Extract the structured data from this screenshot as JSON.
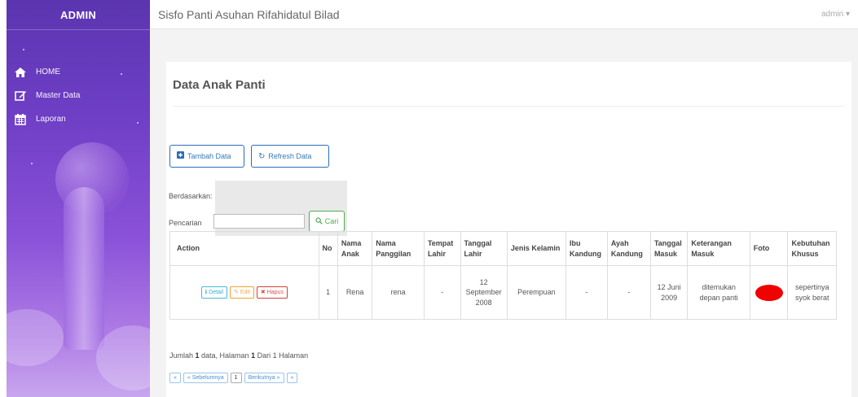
{
  "sidebar": {
    "brand": "ADMIN",
    "items": [
      {
        "label": "HOME",
        "icon": "home-icon"
      },
      {
        "label": "Master Data",
        "icon": "edit-icon"
      },
      {
        "label": "Laporan",
        "icon": "calendar-icon"
      }
    ]
  },
  "topbar": {
    "title": "Sisfo Panti Asuhan Rifahidatul Bilad",
    "user": "admin ▾"
  },
  "page": {
    "title": "Data Anak Panti",
    "btn_add": "Tambah Data",
    "btn_refresh": "Refresh Data",
    "filter_label": "Berdasarkan:",
    "search_label": "Pencarian",
    "btn_search": "Cari"
  },
  "table": {
    "headers": [
      "Action",
      "No",
      "Nama Anak",
      "Nama Panggilan",
      "Tempat Lahir",
      "Tanggal Lahir",
      "Jenis Kelamin",
      "Ibu Kandung",
      "Ayah Kandung",
      "Tanggal Masuk",
      "Keterangan Masuk",
      "Foto",
      "Kebutuhan Khusus"
    ],
    "actions": {
      "detail": "Detail",
      "edit": "Edit",
      "hapus": "Hapus"
    },
    "rows": [
      {
        "no": "1",
        "nama_anak": "Rena",
        "nama_panggilan": "rena",
        "tempat_lahir": "-",
        "tanggal_lahir": "12 September 2008",
        "jenis_kelamin": "Perempuan",
        "ibu_kandung": "-",
        "ayah_kandung": "-",
        "tanggal_masuk": "12 Juni 2009",
        "keterangan_masuk": "ditemukan depan panti",
        "kebutuhan_khusus": "sepertinya syok berat"
      }
    ]
  },
  "summary": {
    "prefix": "Jumlah ",
    "count": "1",
    "mid": " data, Halaman ",
    "page": "1",
    "of": " Dari ",
    "total": "1",
    "suffix": " Halaman"
  },
  "pager": {
    "first": "«",
    "prev": "« Sebelumnya",
    "current": "1",
    "next": "Berikutnya »",
    "last": "»"
  },
  "colors": {
    "sidebar_top": "#5b35b0",
    "sidebar_bottom": "#c8a6ee",
    "primary": "#337ab7",
    "success": "#4cae4c",
    "photo": "#f00000"
  }
}
